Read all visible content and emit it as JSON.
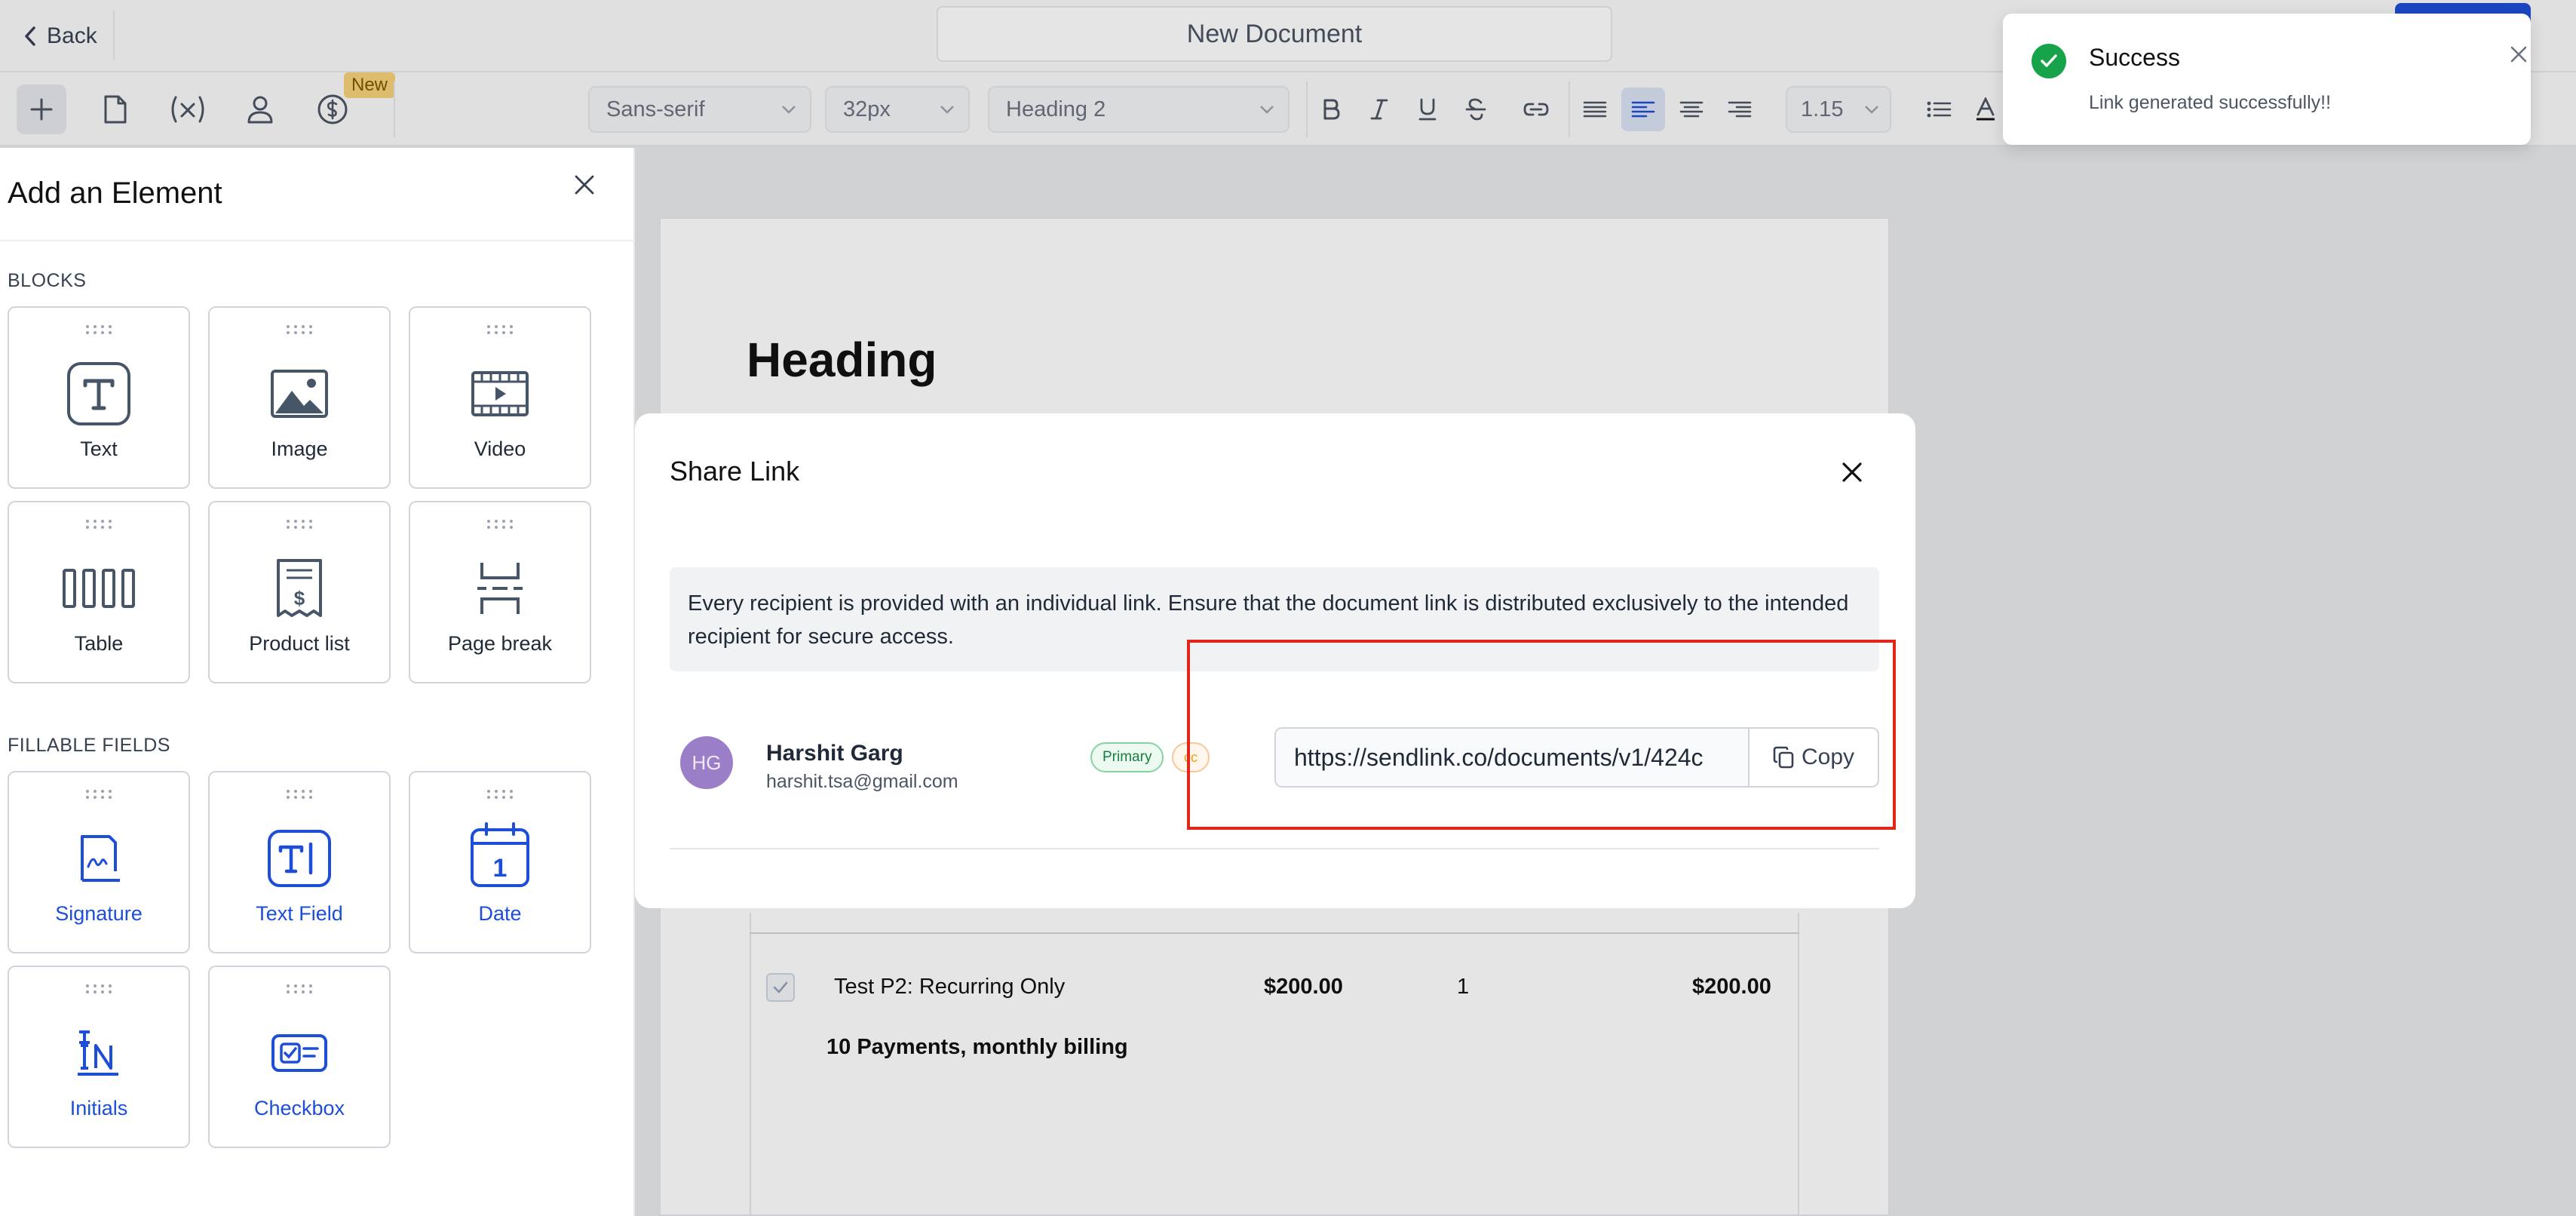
{
  "header": {
    "back_label": "Back",
    "doc_title": "New Document"
  },
  "toolbar": {
    "new_badge": "New",
    "font_family": "Sans-serif",
    "font_size": "32px",
    "text_style": "Heading 2",
    "line_height": "1.15"
  },
  "sidebar": {
    "title": "Add an Element",
    "blocks_label": "BLOCKS",
    "blocks": [
      {
        "label": "Text",
        "icon": "text-icon"
      },
      {
        "label": "Image",
        "icon": "image-icon"
      },
      {
        "label": "Video",
        "icon": "video-icon"
      },
      {
        "label": "Table",
        "icon": "table-icon"
      },
      {
        "label": "Product list",
        "icon": "product-list-icon"
      },
      {
        "label": "Page break",
        "icon": "page-break-icon"
      }
    ],
    "fields_label": "FILLABLE FIELDS",
    "fields": [
      {
        "label": "Signature",
        "icon": "signature-icon"
      },
      {
        "label": "Text Field",
        "icon": "text-field-icon"
      },
      {
        "label": "Date",
        "icon": "calendar-icon"
      },
      {
        "label": "Initials",
        "icon": "initials-icon"
      },
      {
        "label": "Checkbox",
        "icon": "checkbox-icon"
      }
    ]
  },
  "document": {
    "heading": "Heading",
    "product": {
      "name": "Test P2: Recurring Only",
      "price": "$200.00",
      "qty": "1",
      "total": "$200.00",
      "billing": "10 Payments, monthly billing"
    }
  },
  "modal": {
    "title": "Share Link",
    "info": "Every recipient is provided with an individual link. Ensure that the document link is distributed exclusively to the intended recipient for secure access.",
    "recipient": {
      "initials": "HG",
      "name": "Harshit Garg",
      "email": "harshit.tsa@gmail.com",
      "role_badge": "Primary",
      "cc_badge": "cc"
    },
    "link_value": "https://sendlink.co/documents/v1/424c",
    "copy_label": "Copy"
  },
  "toast": {
    "title": "Success",
    "message": "Link generated successfully!!"
  },
  "colors": {
    "accent": "#1d4ed8",
    "success": "#16a34a",
    "highlight": "#e3261a",
    "avatar": "#9b7ec8"
  }
}
